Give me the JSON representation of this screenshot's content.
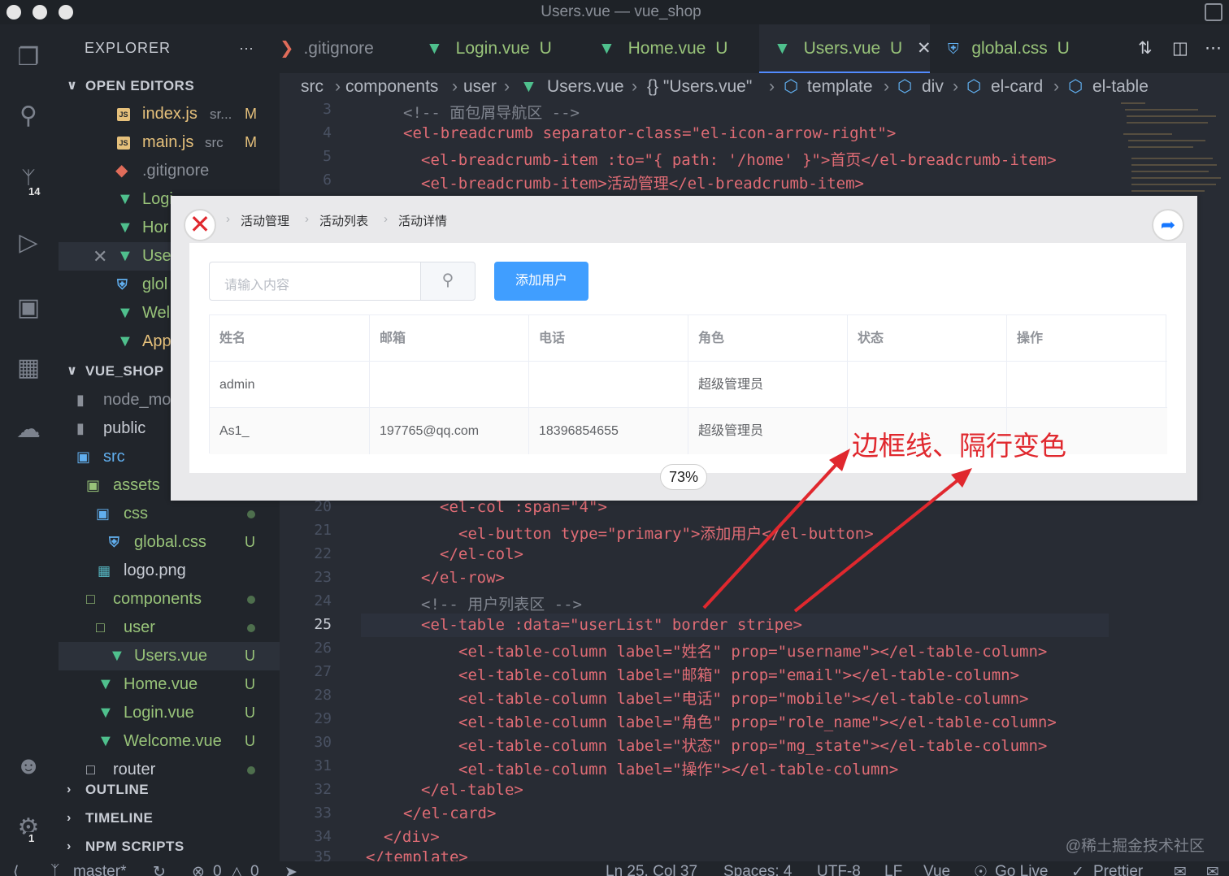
{
  "window": {
    "title": "Users.vue — vue_shop"
  },
  "activity_bar": {
    "scm_badge": "14",
    "settings_badge": "1"
  },
  "sidebar": {
    "header": "EXPLORER",
    "header_more": "···",
    "open_editors_title": "OPEN EDITORS",
    "open_editors": [
      {
        "name": "index.js",
        "desc": "sr...",
        "status": "M",
        "kind": "js"
      },
      {
        "name": "main.js",
        "desc": "src",
        "status": "M",
        "kind": "js"
      },
      {
        "name": ".gitignore",
        "desc": "",
        "status": "",
        "kind": "git"
      },
      {
        "name": "Logi",
        "desc": "",
        "status": "",
        "kind": "vue"
      },
      {
        "name": "Hor",
        "desc": "",
        "status": "",
        "kind": "vue"
      },
      {
        "name": "Use",
        "desc": "",
        "status": "",
        "kind": "vue"
      },
      {
        "name": "glol",
        "desc": "",
        "status": "",
        "kind": "css"
      },
      {
        "name": "Wel",
        "desc": "",
        "status": "",
        "kind": "vue"
      },
      {
        "name": "App",
        "desc": "",
        "status": "",
        "kind": "vue"
      }
    ],
    "project_title": "VUE_SHOP",
    "tree": [
      {
        "name": "node_mo",
        "status": ""
      },
      {
        "name": "public",
        "status": ""
      },
      {
        "name": "src",
        "status": ""
      },
      {
        "name": "assets",
        "status": ""
      },
      {
        "name": "css",
        "status": ""
      },
      {
        "name": "global.css",
        "status": "U"
      },
      {
        "name": "logo.png",
        "status": ""
      },
      {
        "name": "components",
        "status": ""
      },
      {
        "name": "user",
        "status": ""
      },
      {
        "name": "Users.vue",
        "status": "U"
      },
      {
        "name": "Home.vue",
        "status": "U"
      },
      {
        "name": "Login.vue",
        "status": "U"
      },
      {
        "name": "Welcome.vue",
        "status": "U"
      },
      {
        "name": "router",
        "status": ""
      }
    ],
    "outline": "OUTLINE",
    "timeline": "TIMELINE",
    "npm_scripts": "NPM SCRIPTS"
  },
  "tabs": [
    {
      "label": ".gitignore",
      "status": ""
    },
    {
      "label": "Login.vue",
      "status": "U"
    },
    {
      "label": "Home.vue",
      "status": "U"
    },
    {
      "label": "Users.vue",
      "status": "U",
      "active": true
    },
    {
      "label": "global.css",
      "status": "U"
    }
  ],
  "breadcrumb": [
    "src",
    "components",
    "user",
    "Users.vue",
    "{} \"Users.vue\"",
    "template",
    "div",
    "el-card",
    "el-table"
  ],
  "code_top": [
    {
      "num": "3",
      "text": "<!-- 面包屑导航区 -->"
    },
    {
      "num": "4",
      "text": "<el-breadcrumb separator-class=\"el-icon-arrow-right\">"
    },
    {
      "num": "5",
      "text": "<el-breadcrumb-item :to=\"{ path: '/home' }\">首页</el-breadcrumb-item>"
    },
    {
      "num": "6",
      "text": "<el-breadcrumb-item>活动管理</el-breadcrumb-item>"
    }
  ],
  "code_bottom": [
    {
      "num": "20",
      "text": "<el-col :span=\"4\">"
    },
    {
      "num": "21",
      "text": "<el-button type=\"primary\">添加用户</el-button>"
    },
    {
      "num": "22",
      "text": "</el-col>"
    },
    {
      "num": "23",
      "text": "</el-row>"
    },
    {
      "num": "24",
      "text": "<!-- 用户列表区 -->"
    },
    {
      "num": "25",
      "text": "<el-table :data=\"userList\" border stripe>"
    },
    {
      "num": "26",
      "text": "<el-table-column label=\"姓名\" prop=\"username\"></el-table-column>"
    },
    {
      "num": "27",
      "text": "<el-table-column label=\"邮箱\" prop=\"email\"></el-table-column>"
    },
    {
      "num": "28",
      "text": "<el-table-column label=\"电话\" prop=\"mobile\"></el-table-column>"
    },
    {
      "num": "29",
      "text": "<el-table-column label=\"角色\" prop=\"role_name\"></el-table-column>"
    },
    {
      "num": "30",
      "text": "<el-table-column label=\"状态\" prop=\"mg_state\"></el-table-column>"
    },
    {
      "num": "31",
      "text": "<el-table-column label=\"操作\"></el-table-column>"
    },
    {
      "num": "32",
      "text": "</el-table>"
    },
    {
      "num": "33",
      "text": "</el-card>"
    },
    {
      "num": "34",
      "text": "</div>"
    },
    {
      "num": "35",
      "text": "</template>"
    }
  ],
  "popup": {
    "breadcrumb": [
      "活动管理",
      "活动列表",
      "活动详情"
    ],
    "search_placeholder": "请输入内容",
    "add_button": "添加用户",
    "columns": [
      "姓名",
      "邮箱",
      "电话",
      "角色",
      "状态",
      "操作"
    ],
    "rows": [
      [
        "admin",
        "",
        "",
        "超级管理员",
        "",
        ""
      ],
      [
        "As1_",
        "197765@qq.com",
        "18396854655",
        "超级管理员",
        "",
        ""
      ]
    ],
    "zoom": "73%"
  },
  "annotation": {
    "text": "边框线、隔行变色",
    "color": "#e0282e"
  },
  "status_bar": {
    "branch": "master*",
    "errors": "0",
    "warnings": "0",
    "position": "Ln 25, Col 37",
    "spaces": "Spaces: 4",
    "encoding": "UTF-8",
    "eol": "LF",
    "language": "Vue",
    "golive": "Go Live",
    "prettier": "Prettier"
  },
  "watermark": "@稀土掘金技术社区"
}
